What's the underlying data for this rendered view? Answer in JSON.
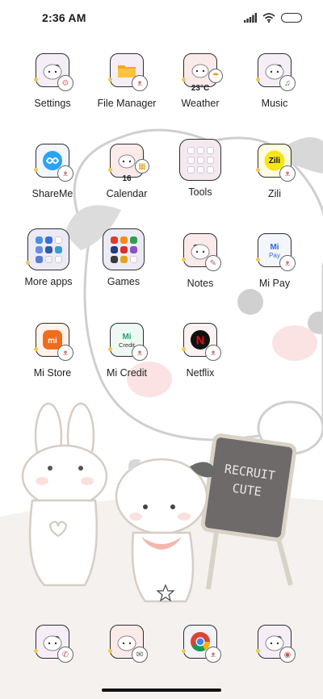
{
  "status_bar": {
    "time": "2:36 AM",
    "icons": [
      "signal-icon",
      "wifi-icon",
      "battery-icon"
    ]
  },
  "apps": [
    {
      "label": "Settings",
      "icon": "gear-icon"
    },
    {
      "label": "File Manager",
      "icon": "folder-icon"
    },
    {
      "label": "Weather",
      "icon": "weather-icon",
      "extra": "23°C"
    },
    {
      "label": "Music",
      "icon": "music-note-icon"
    },
    {
      "label": "ShareMe",
      "icon": "shareme-icon"
    },
    {
      "label": "Calendar",
      "icon": "calendar-icon",
      "extra": "16"
    },
    {
      "label": "Tools",
      "icon": "tools-folder-icon"
    },
    {
      "label": "Zili",
      "icon": "zili-icon",
      "extra": "Zili"
    },
    {
      "label": "More apps",
      "icon": "more-apps-folder-icon"
    },
    {
      "label": "Games",
      "icon": "games-folder-icon"
    },
    {
      "label": "Notes",
      "icon": "notes-icon"
    },
    {
      "label": "Mi Pay",
      "icon": "mi-pay-icon",
      "extra": "Pay"
    },
    {
      "label": "Mi Store",
      "icon": "mi-store-icon"
    },
    {
      "label": "Mi Credit",
      "icon": "mi-credit-icon",
      "extra": "Credit"
    },
    {
      "label": "Netflix",
      "icon": "netflix-icon",
      "extra": "N"
    }
  ],
  "dock": [
    {
      "icon": "phone-icon"
    },
    {
      "icon": "messages-icon"
    },
    {
      "icon": "chrome-icon"
    },
    {
      "icon": "camera-icon"
    }
  ],
  "wallpaper": {
    "sign_line1": "RECRUIT",
    "sign_line2": "CUTE"
  },
  "colors": {
    "tile_bg": "#f6eef6",
    "tile_border": "#2e2e2e",
    "accent_orange": "#f26b1d",
    "netflix_red": "#e50914",
    "mi_green": "#1aa86b"
  }
}
